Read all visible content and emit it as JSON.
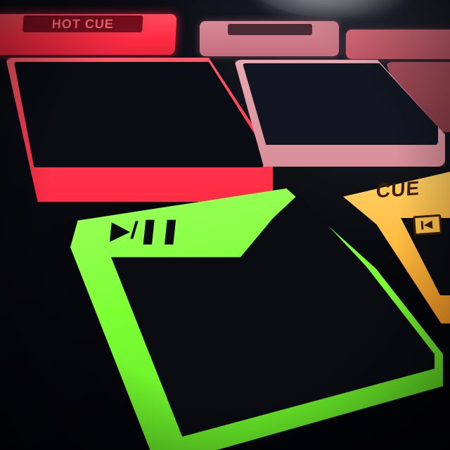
{
  "hot_cue_button": {
    "label": "HOT CUE"
  },
  "play_pad": {
    "label": "▶/❚❚"
  },
  "cue_pad": {
    "label": "CUE",
    "icon": "skip-to-start-icon"
  },
  "colors": {
    "hot_cue": "#ff2c44",
    "pad_red": "#ff3b52",
    "pad_pink": "#d98e98",
    "pad_green": "#7dff34",
    "pad_orange": "#ffb83c",
    "pad_top": "#0a0c12"
  }
}
